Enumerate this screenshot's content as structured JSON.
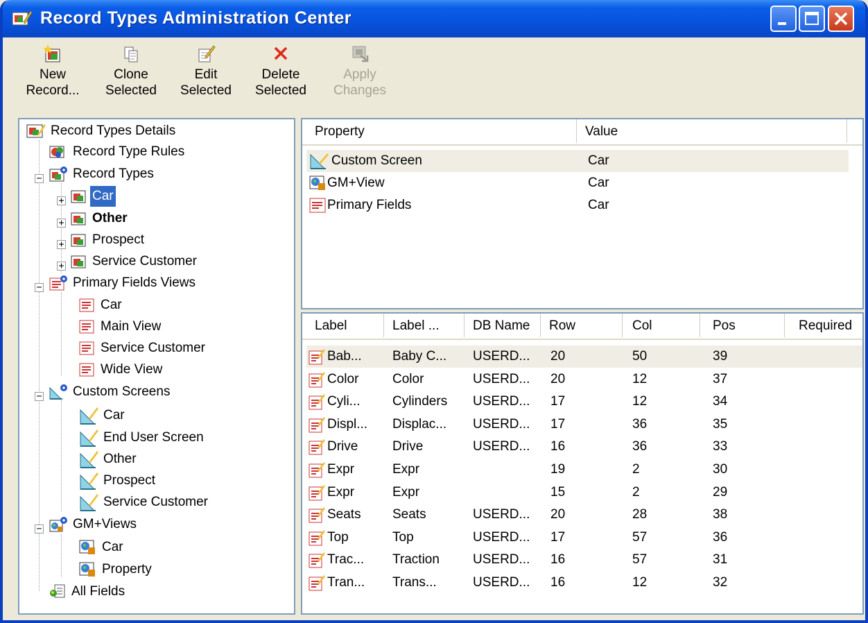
{
  "window": {
    "title": "Record Types Administration Center"
  },
  "toolbar": {
    "new": {
      "line1": "New",
      "line2": "Record..."
    },
    "clone": {
      "line1": "Clone",
      "line2": "Selected"
    },
    "edit": {
      "line1": "Edit",
      "line2": "Selected"
    },
    "delete": {
      "line1": "Delete",
      "line2": "Selected"
    },
    "apply": {
      "line1": "Apply",
      "line2": "Changes"
    }
  },
  "tree": {
    "root": "Record Types Details",
    "rules": "Record Type Rules",
    "record_types": {
      "label": "Record Types",
      "items": [
        "Car",
        "Other",
        "Prospect",
        "Service Customer"
      ]
    },
    "primary_fields_views": {
      "label": "Primary Fields Views",
      "items": [
        "Car",
        "Main View",
        "Service Customer",
        "Wide View"
      ]
    },
    "custom_screens": {
      "label": "Custom Screens",
      "items": [
        "Car",
        "End User Screen",
        "Other",
        "Prospect",
        "Service Customer"
      ]
    },
    "gm_views": {
      "label": "GM+Views",
      "items": [
        "Car",
        "Property"
      ]
    },
    "all_fields": "All Fields"
  },
  "properties": {
    "columns": [
      "Property",
      "Value"
    ],
    "rows": [
      {
        "property": "Custom Screen",
        "value": "Car"
      },
      {
        "property": "GM+View",
        "value": "Car"
      },
      {
        "property": "Primary Fields",
        "value": "Car"
      }
    ]
  },
  "fields": {
    "columns": [
      "Label",
      "Label ...",
      "DB Name",
      "Row",
      "Col",
      "Pos",
      "Required"
    ],
    "rows": [
      [
        "Bab...",
        "Baby C...",
        "USERD...",
        "20",
        "50",
        "39",
        ""
      ],
      [
        "Color",
        "Color",
        "USERD...",
        "20",
        "12",
        "37",
        ""
      ],
      [
        "Cyli...",
        "Cylinders",
        "USERD...",
        "17",
        "12",
        "34",
        ""
      ],
      [
        "Displ...",
        "Displac...",
        "USERD...",
        "17",
        "36",
        "35",
        ""
      ],
      [
        "Drive",
        "Drive",
        "USERD...",
        "16",
        "36",
        "33",
        ""
      ],
      [
        "Expr",
        "Expr",
        "",
        "19",
        "2",
        "30",
        ""
      ],
      [
        "Expr",
        "Expr",
        "",
        "15",
        "2",
        "29",
        ""
      ],
      [
        "Seats",
        "Seats",
        "USERD...",
        "20",
        "28",
        "38",
        ""
      ],
      [
        "Top",
        "Top",
        "USERD...",
        "17",
        "57",
        "36",
        ""
      ],
      [
        "Trac...",
        "Traction",
        "USERD...",
        "16",
        "57",
        "31",
        ""
      ],
      [
        "Tran...",
        "Trans...",
        "USERD...",
        "16",
        "12",
        "32",
        ""
      ]
    ]
  }
}
